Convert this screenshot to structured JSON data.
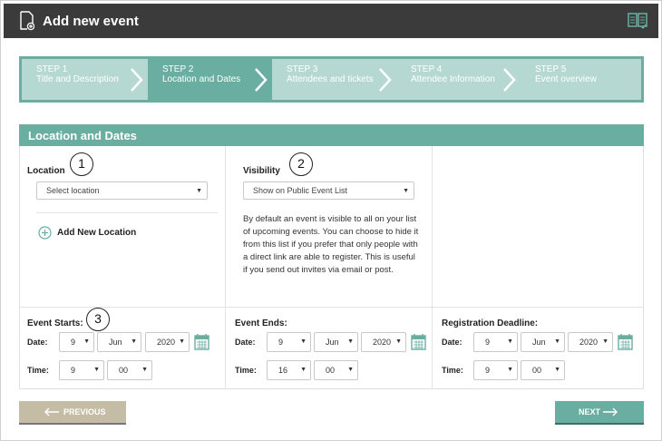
{
  "header": {
    "title": "Add new event",
    "left_icon": "document-add-icon",
    "right_icon": "book-icon"
  },
  "steps": [
    {
      "num": "STEP 1",
      "label": "Title and Description",
      "state": "done"
    },
    {
      "num": "STEP 2",
      "label": "Location and Dates",
      "state": "active"
    },
    {
      "num": "STEP 3",
      "label": "Attendees and tickets",
      "state": "todo"
    },
    {
      "num": "STEP 4",
      "label": "Attendee Information",
      "state": "todo"
    },
    {
      "num": "STEP 5",
      "label": "Event overview",
      "state": "todo"
    }
  ],
  "section": {
    "title": "Location and Dates"
  },
  "location": {
    "label": "Location",
    "select_value": "Select location",
    "add_label": "Add New Location"
  },
  "visibility": {
    "label": "Visibility",
    "select_value": "Show on Public Event List",
    "description": "By default an event is visible to all on your list of upcoming events. You can choose to hide it from this list if you prefer that only people with a direct link are able to register. This is useful if you send out invites via email or post."
  },
  "callouts": [
    "1",
    "2",
    "3"
  ],
  "event_starts": {
    "label": "Event Starts:",
    "date_label": "Date:",
    "day": "9",
    "month": "Jun",
    "year": "2020",
    "time_label": "Time:",
    "hour": "9",
    "minute": "00"
  },
  "event_ends": {
    "label": "Event Ends:",
    "date_label": "Date:",
    "day": "9",
    "month": "Jun",
    "year": "2020",
    "time_label": "Time:",
    "hour": "16",
    "minute": "00"
  },
  "registration_deadline": {
    "label": "Registration Deadline:",
    "date_label": "Date:",
    "day": "9",
    "month": "Jun",
    "year": "2020",
    "time_label": "Time:",
    "hour": "9",
    "minute": "00"
  },
  "buttons": {
    "previous": "PREVIOUS",
    "next": "NEXT"
  },
  "colors": {
    "accent": "#6aaea2",
    "accent_light": "#b6d8d2",
    "header_bg": "#3b3b3b",
    "prev_button": "#c4bca4"
  }
}
